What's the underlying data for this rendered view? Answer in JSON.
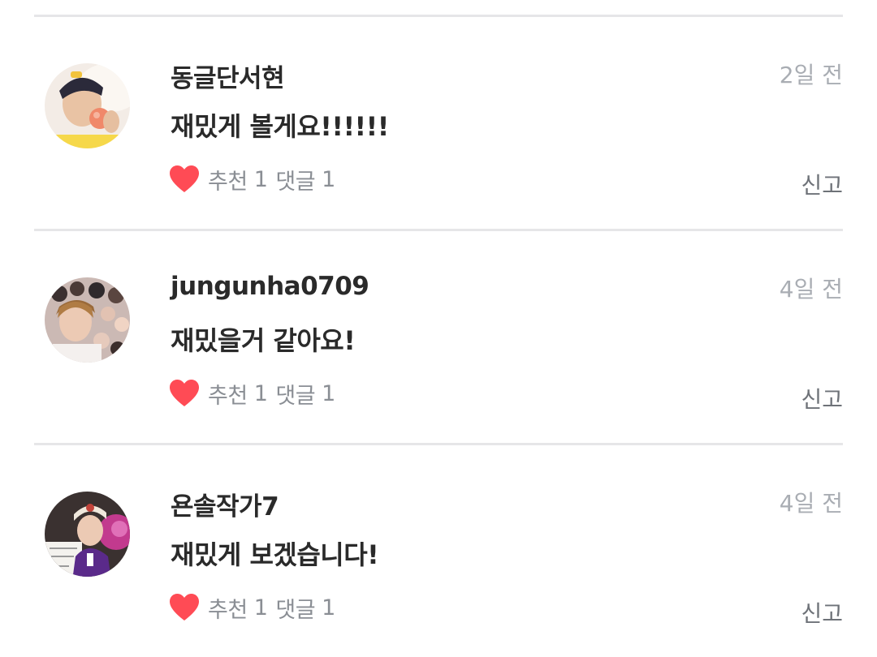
{
  "colors": {
    "heart": "#ff4b55",
    "divider": "#e6e6e8",
    "muted_text": "#a9adb3",
    "stat_text": "#8a8e94"
  },
  "comments": [
    {
      "author": "동글단서현",
      "time": "2일 전",
      "text": "재밌게 볼게요!!!!!!",
      "like_icon": "heart-icon",
      "like_label": "추천",
      "like_count": "1",
      "reply_label": "댓글",
      "reply_count": "1",
      "report_label": "신고"
    },
    {
      "author": "jungunha0709",
      "time": "4일 전",
      "text": "재밌을거 같아요!",
      "like_icon": "heart-icon",
      "like_label": "추천",
      "like_count": "1",
      "reply_label": "댓글",
      "reply_count": "1",
      "report_label": "신고"
    },
    {
      "author": "욘솔작가7",
      "time": "4일 전",
      "text": "재밌게 보겠습니다!",
      "like_icon": "heart-icon",
      "like_label": "추천",
      "like_count": "1",
      "reply_label": "댓글",
      "reply_count": "1",
      "report_label": "신고"
    }
  ]
}
